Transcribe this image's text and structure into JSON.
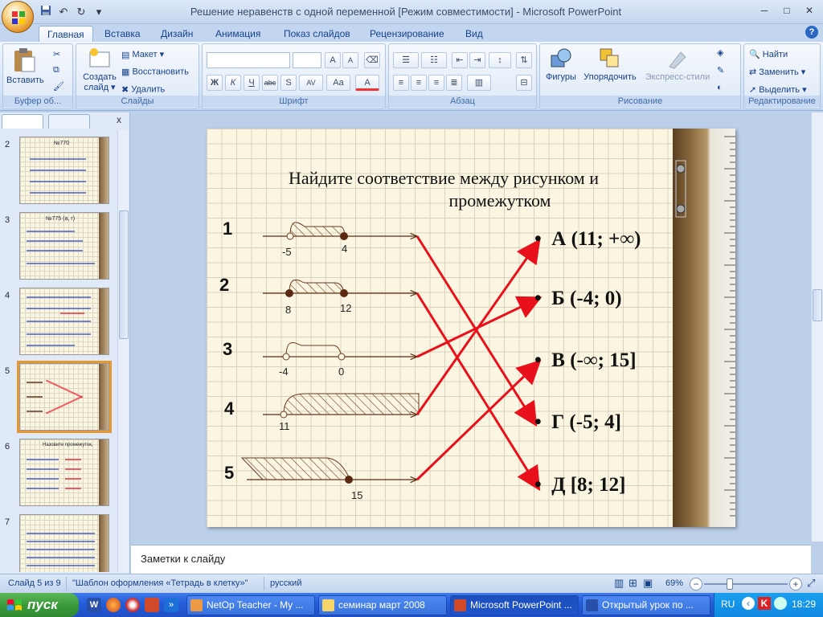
{
  "window": {
    "title": "Решение неравенств с одной переменной [Режим совместимости] - Microsoft PowerPoint",
    "min": "─",
    "max": "□",
    "close": "✕"
  },
  "qat": {
    "undo": "↶",
    "redo": "↻",
    "more": "▾"
  },
  "tabs": [
    {
      "label": "Главная"
    },
    {
      "label": "Вставка"
    },
    {
      "label": "Дизайн"
    },
    {
      "label": "Анимация"
    },
    {
      "label": "Показ слайдов"
    },
    {
      "label": "Рецензирование"
    },
    {
      "label": "Вид"
    }
  ],
  "help": "?",
  "ribbon": {
    "clipboard": {
      "label": "Буфер об...",
      "paste": "Вставить"
    },
    "slides": {
      "label": "Слайды",
      "create": "Создать",
      "create2": "слайд ▾",
      "layout": "Макет ▾",
      "reset": "Восстановить",
      "delete": "Удалить"
    },
    "font": {
      "label": "Шрифт",
      "grow": "A",
      "shrink": "A",
      "bold": "Ж",
      "italic": "К",
      "underline": "Ч",
      "strike": "abc",
      "shadow": "S",
      "spacing": "AV",
      "case": "Aa",
      "color": "A"
    },
    "paragraph": {
      "label": "Абзац"
    },
    "drawing": {
      "label": "Рисование",
      "shapes": "Фигуры",
      "arrange": "Упорядочить",
      "styles": "Экспресс-стили"
    },
    "editing": {
      "label": "Редактирование",
      "find": "Найти",
      "replace": "Заменить ▾",
      "select": "Выделить ▾"
    }
  },
  "thumbnails": [
    {
      "num": "2",
      "title": "№770"
    },
    {
      "num": "3",
      "title": "№775 (а, г)"
    },
    {
      "num": "4",
      "title": ""
    },
    {
      "num": "5",
      "title": ""
    },
    {
      "num": "6",
      "title": "Назовите промежуток,"
    },
    {
      "num": "7",
      "title": ""
    }
  ],
  "slide": {
    "title_line1": "Найдите соответствие между рисунком и",
    "title_line2": "промежутком",
    "rows": [
      {
        "num": "1",
        "a": "-5",
        "b": "4"
      },
      {
        "num": "2",
        "a": "8",
        "b": "12"
      },
      {
        "num": "3",
        "a": "-4",
        "b": "0"
      },
      {
        "num": "4",
        "a": "11"
      },
      {
        "num": "5",
        "b": "15"
      }
    ],
    "answers": [
      {
        "text": "А  (11; +∞)"
      },
      {
        "text": "Б  (-4; 0)"
      },
      {
        "text": "В   (-∞; 15]"
      },
      {
        "text": "Г  (-5;  4]"
      },
      {
        "text": "Д  [8; 12]"
      }
    ],
    "bullet": "•",
    "arrow_color": "#e8101a",
    "line_color": "#5a2a10"
  },
  "notes_placeholder": "Заметки к слайду",
  "status": {
    "slide": "Слайд 5 из 9",
    "theme": "\"Шаблон оформления «Тетрадь в клетку»\"",
    "lang": "русский",
    "zoom": "69%",
    "zoom_level": 0.31
  },
  "taskbar": {
    "start": "пуск",
    "tasks": [
      {
        "label": "NetOp Teacher - My ..."
      },
      {
        "label": "семинар март 2008"
      },
      {
        "label": "Microsoft PowerPoint ..."
      },
      {
        "label": "Открытый урок по ..."
      }
    ],
    "lang": "RU",
    "time": "18:29"
  }
}
